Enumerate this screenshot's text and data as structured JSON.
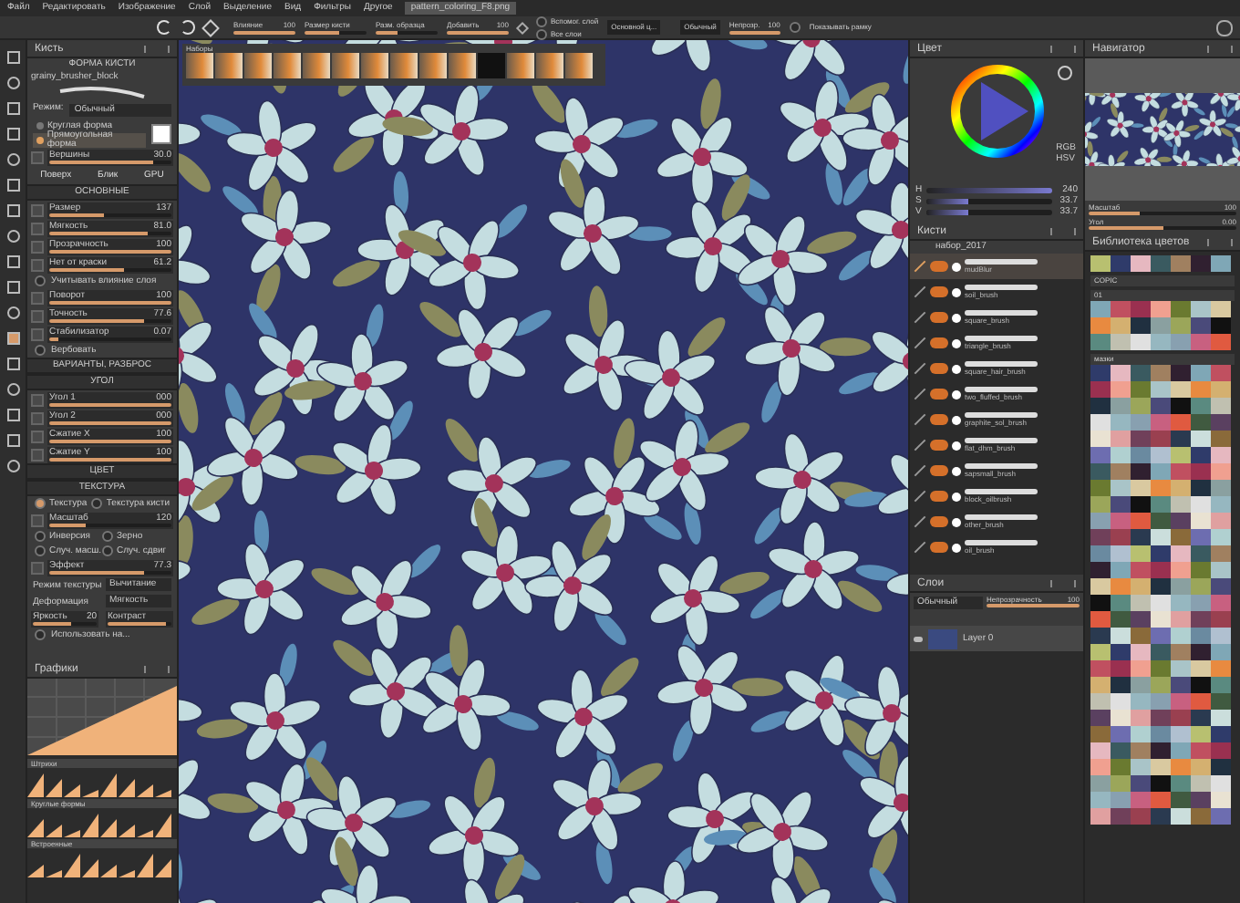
{
  "menu": [
    "Файл",
    "Редактировать",
    "Изображение",
    "Слой",
    "Выделение",
    "Вид",
    "Фильтры",
    "Другое"
  ],
  "document_tab": "pattern_coloring_F8.png",
  "toolbar": {
    "sliders": [
      {
        "label": "Влияние",
        "value": "100",
        "level": 1
      },
      {
        "label": "Размер кисти",
        "level": 0.55
      },
      {
        "label": "Разм. образца",
        "level": 0.35
      },
      {
        "label": "Добавить",
        "value": "100",
        "level": 1
      }
    ],
    "checks": [
      {
        "label": "Вспомог. слой",
        "checked": false
      },
      {
        "label": "Все слои",
        "checked": false
      }
    ],
    "source": "Основной ц...",
    "blend": "Обычный",
    "opacity": {
      "label": "Непрозр.",
      "value": "100",
      "level": 1
    },
    "frame": {
      "label": "Показывать рамку",
      "checked": false
    }
  },
  "presets_strip": {
    "title": "Наборы"
  },
  "brush_editor": {
    "title": "Кисть",
    "header": "ФОРМА КИСТИ",
    "brush_name": "grainy_brusher_block",
    "mode_label": "Режим:",
    "mode": "Обычный",
    "shapes": [
      {
        "label": "Круглая форма",
        "selected": false
      },
      {
        "label": "Прямоугольная форма",
        "selected": true
      }
    ],
    "vertices": {
      "label": "Вершины",
      "value": "30.0",
      "level": 0.85
    },
    "buttons": [
      "Поверх",
      "Блик",
      "GPU"
    ],
    "sections": [
      {
        "title": "ОСНОВНЫЕ",
        "rows": [
          {
            "kind": "slider",
            "label": "Размер",
            "value": "137",
            "level": 0.45
          },
          {
            "kind": "slider",
            "label": "Мягкость",
            "value": "81.0",
            "level": 0.8
          },
          {
            "kind": "slider",
            "label": "Прозрачность",
            "value": "100",
            "level": 1
          },
          {
            "kind": "slider",
            "label": "Нет от краски",
            "value": "61.2",
            "level": 0.61
          },
          {
            "kind": "check",
            "label": "Учитывать влияние слоя",
            "checked": false
          },
          {
            "kind": "slider",
            "label": "Поворот",
            "value": "100",
            "level": 1
          },
          {
            "kind": "slider",
            "label": "Точность",
            "value": "77.6",
            "level": 0.78
          },
          {
            "kind": "slider",
            "label": "Стабилизатор",
            "value": "0.07",
            "level": 0.07
          },
          {
            "kind": "check",
            "label": "Вербовать",
            "checked": false
          }
        ]
      },
      {
        "title": "ВАРИАНТЫ, РАЗБРОС"
      },
      {
        "title": "УГОЛ",
        "rows": [
          {
            "kind": "slider",
            "label": "Угол 1",
            "value": "000",
            "level": 1
          },
          {
            "kind": "slider",
            "label": "Угол 2",
            "value": "000",
            "level": 1
          },
          {
            "kind": "slider",
            "label": "Сжатие X",
            "value": "100",
            "level": 1
          },
          {
            "kind": "slider",
            "label": "Сжатие Y",
            "value": "100",
            "level": 1
          }
        ]
      },
      {
        "title": "ЦВЕТ"
      },
      {
        "title": "ТЕКСТУРА",
        "rows": [
          {
            "kind": "pair",
            "items": [
              {
                "label": "Текстура",
                "checked": true
              },
              {
                "label": "Текстура кисти",
                "checked": false
              }
            ]
          },
          {
            "kind": "slider",
            "label": "Масштаб",
            "value": "120",
            "level": 0.3
          },
          {
            "kind": "pair",
            "items": [
              {
                "label": "Инверсия",
                "checked": false
              },
              {
                "label": "Зерно",
                "checked": false
              }
            ]
          },
          {
            "kind": "pair",
            "items": [
              {
                "label": "Случ. масш.",
                "checked": false
              },
              {
                "label": "Случ. сдвиг",
                "checked": false
              }
            ]
          },
          {
            "kind": "slider",
            "label": "Эффект",
            "value": "77.3",
            "level": 0.77
          },
          {
            "kind": "select",
            "label": "Режим текстуры",
            "value": "Вычитание"
          },
          {
            "kind": "select",
            "label": "Деформация",
            "value": "Мягкость"
          },
          {
            "kind": "duo",
            "items": [
              {
                "label": "Яркость",
                "value": "20",
                "level": 0.6
              },
              {
                "label": "Контраст",
                "level": 0.9
              }
            ]
          },
          {
            "kind": "check",
            "label": "Использовать на...",
            "checked": false
          }
        ]
      }
    ]
  },
  "curves": {
    "title": "Графики"
  },
  "curve_presets": {
    "groups": [
      "Штрихи",
      "Круглые формы",
      "Встроенные"
    ]
  },
  "color": {
    "title": "Цвет",
    "models": [
      "RGB",
      "HSV"
    ],
    "channels": [
      {
        "label": "H",
        "value": "240",
        "level": 1
      },
      {
        "label": "S",
        "value": "33.7",
        "level": 0.34
      },
      {
        "label": "V",
        "value": "33.7",
        "level": 0.34
      }
    ]
  },
  "brushes": {
    "title": "Кисти",
    "set": "набор_2017",
    "items": [
      {
        "name": "mudBlur",
        "selected": true
      },
      {
        "name": "soil_brush",
        "selected": false
      },
      {
        "name": "square_brush",
        "selected": false
      },
      {
        "name": "triangle_brush",
        "selected": false
      },
      {
        "name": "square_hair_brush",
        "selected": false
      },
      {
        "name": "two_fluffed_brush",
        "selected": false
      },
      {
        "name": "graphite_sol_brush",
        "selected": false
      },
      {
        "name": "flat_dhm_brush",
        "selected": false
      },
      {
        "name": "sapsmall_brush",
        "selected": false
      },
      {
        "name": "block_oilbrush",
        "selected": false
      },
      {
        "name": "other_brush",
        "selected": false
      },
      {
        "name": "oil_brush",
        "selected": false
      }
    ]
  },
  "layers": {
    "title": "Слои",
    "blend": "Обычный",
    "opacity": {
      "label": "Непрозрачность",
      "value": "100",
      "level": 1
    },
    "items": [
      {
        "name": "Layer 0",
        "visible": true
      }
    ]
  },
  "navigator": {
    "title": "Навигатор",
    "sliders": [
      {
        "label": "Масштаб",
        "value": "100",
        "level": 0.35
      },
      {
        "label": "Угол",
        "value": "0.00",
        "level": 0.5
      }
    ]
  },
  "palette": {
    "title": "Библиотека цветов",
    "groups": [
      "COPIC",
      "01",
      "мазки"
    ]
  }
}
